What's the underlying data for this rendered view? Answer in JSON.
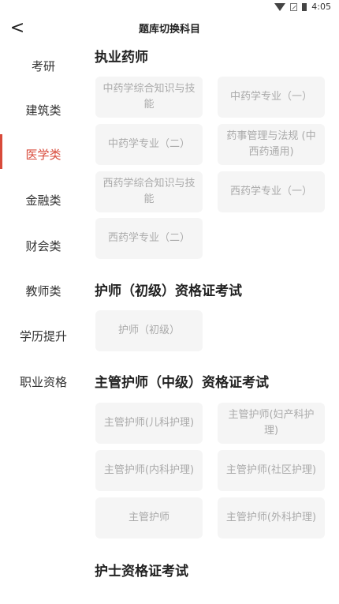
{
  "status": {
    "time": "4:05"
  },
  "header": {
    "back_symbol": "<",
    "title": "题库切换科目"
  },
  "sidebar": {
    "items": [
      {
        "label": "考研"
      },
      {
        "label": "建筑类"
      },
      {
        "label": "医学类"
      },
      {
        "label": "金融类"
      },
      {
        "label": "财会类"
      },
      {
        "label": "教师类"
      },
      {
        "label": "学历提升"
      },
      {
        "label": "职业资格"
      }
    ],
    "active_index": 2
  },
  "sections": [
    {
      "title": "执业药师",
      "items": [
        "中药学综合知识与技能",
        "中药学专业（一）",
        "中药学专业（二）",
        "药事管理与法规 (中西药通用)",
        "西药学综合知识与技能",
        "西药学专业（一）",
        "西药学专业（二）"
      ]
    },
    {
      "title": "护师（初级）资格证考试",
      "items": [
        "护师（初级）"
      ]
    },
    {
      "title": "主管护师（中级）资格证考试",
      "items": [
        "主管护师(儿科护理)",
        "主管护师(妇产科护理)",
        "主管护师(内科护理)",
        "主管护师(社区护理)",
        "主管护师",
        "主管护师(外科护理)"
      ]
    },
    {
      "title": "护士资格证考试",
      "items": []
    }
  ],
  "colors": {
    "accent": "#d84a3a",
    "chip_bg": "#f5f5f5",
    "chip_text": "#aaaaaa"
  }
}
